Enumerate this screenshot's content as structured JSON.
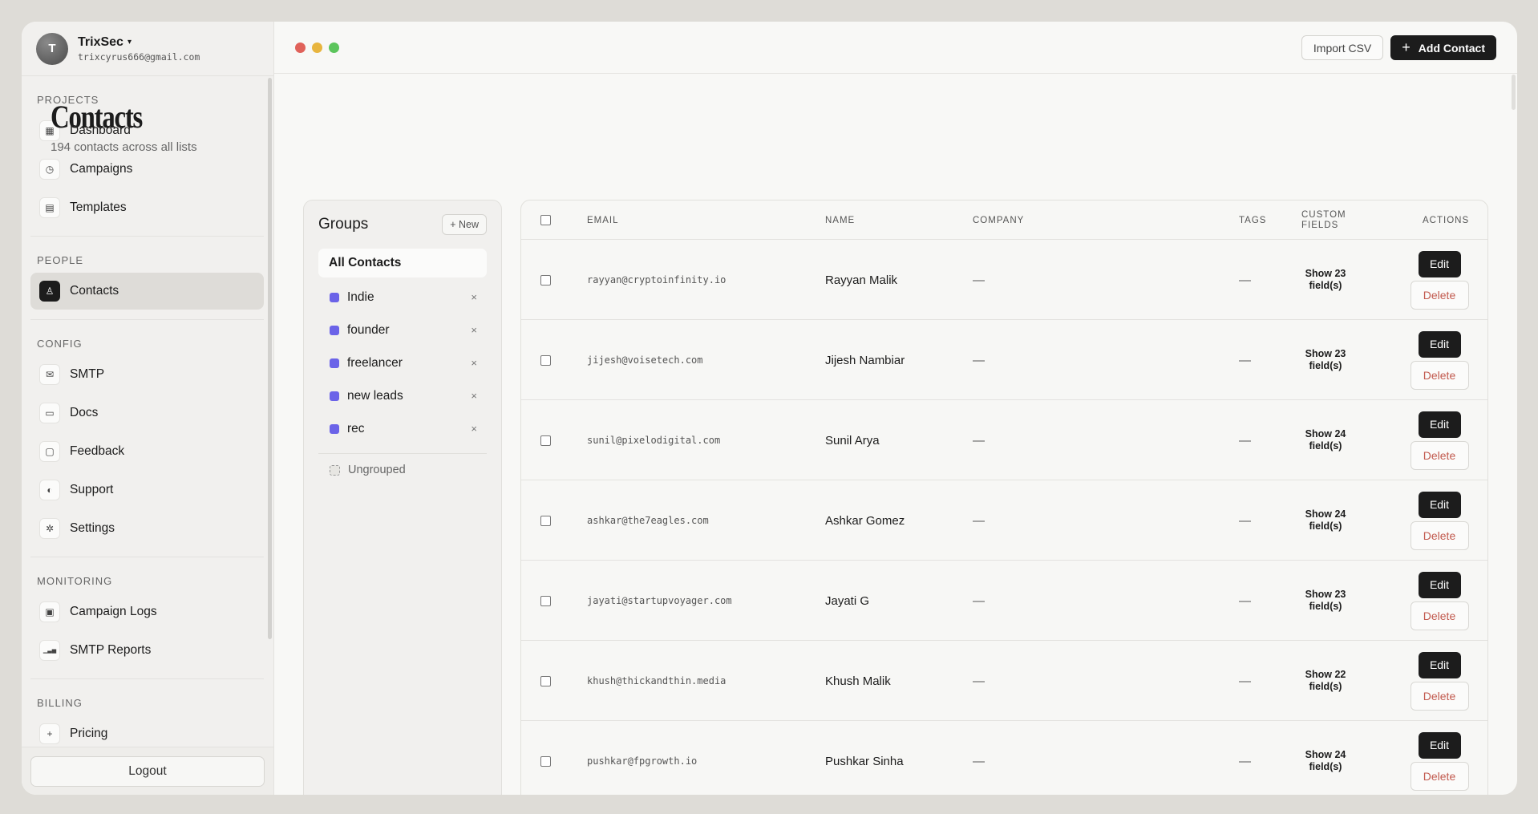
{
  "account": {
    "initial": "T",
    "name": "TrixSec",
    "caret": "▾",
    "email": "trixcyrus666@gmail.com"
  },
  "sidebar": {
    "sections": [
      {
        "title": "PROJECTS",
        "items": [
          {
            "label": "Dashboard",
            "icon": "grid-icon",
            "glyph": "▦"
          },
          {
            "label": "Campaigns",
            "icon": "clock-icon",
            "glyph": "◷"
          },
          {
            "label": "Templates",
            "icon": "document-icon",
            "glyph": "▤"
          }
        ]
      },
      {
        "title": "PEOPLE",
        "items": [
          {
            "label": "Contacts",
            "icon": "user-icon",
            "glyph": "♙",
            "active": true
          }
        ]
      },
      {
        "title": "CONFIG",
        "items": [
          {
            "label": "SMTP",
            "icon": "mail-icon",
            "glyph": "✉"
          },
          {
            "label": "Docs",
            "icon": "folder-icon",
            "glyph": "▭"
          },
          {
            "label": "Feedback",
            "icon": "chat-icon",
            "glyph": "▢"
          },
          {
            "label": "Support",
            "icon": "support-icon",
            "glyph": "◐"
          },
          {
            "label": "Settings",
            "icon": "gear-icon",
            "glyph": "✲"
          }
        ]
      },
      {
        "title": "MONITORING",
        "items": [
          {
            "label": "Campaign Logs",
            "icon": "log-icon",
            "glyph": "▣"
          },
          {
            "label": "SMTP Reports",
            "icon": "bar-chart-icon",
            "glyph": "▁▃▅"
          }
        ]
      },
      {
        "title": "BILLING",
        "items": [
          {
            "label": "Pricing",
            "icon": "plus-icon",
            "glyph": "+"
          }
        ]
      }
    ],
    "logout_label": "Logout"
  },
  "window_dots": [
    "#e0625a",
    "#e8b53e",
    "#5cc55c"
  ],
  "toolbar": {
    "import_label": "Import CSV",
    "add_label": "Add Contact",
    "add_icon": "+"
  },
  "page": {
    "title": "Contacts",
    "subtitle": "194 contacts across all lists"
  },
  "groups": {
    "title": "Groups",
    "new_label": "+ New",
    "all_label": "All Contacts",
    "items": [
      "Indie",
      "founder",
      "freelancer",
      "new leads",
      "rec"
    ],
    "remove_glyph": "×",
    "swatch_color": "#6b63e8",
    "ungrouped_label": "Ungrouped"
  },
  "table": {
    "headers": {
      "email": "EMAIL",
      "name": "NAME",
      "company": "COMPANY",
      "tags": "TAGS",
      "custom_line1": "CUSTOM",
      "custom_line2": "FIELDS",
      "actions": "ACTIONS"
    },
    "edit_label": "Edit",
    "delete_label": "Delete",
    "rows": [
      {
        "email": "rayyan@cryptoinfinity.io",
        "name": "Rayyan Malik",
        "company": "—",
        "tags": "—",
        "custom_line1": "Show 23",
        "custom_line2": "field(s)"
      },
      {
        "email": "jijesh@voisetech.com",
        "name": "Jijesh Nambiar",
        "company": "—",
        "tags": "—",
        "custom_line1": "Show 23",
        "custom_line2": "field(s)"
      },
      {
        "email": "sunil@pixelodigital.com",
        "name": "Sunil Arya",
        "company": "—",
        "tags": "—",
        "custom_line1": "Show 24",
        "custom_line2": "field(s)"
      },
      {
        "email": "ashkar@the7eagles.com",
        "name": "Ashkar Gomez",
        "company": "—",
        "tags": "—",
        "custom_line1": "Show 24",
        "custom_line2": "field(s)"
      },
      {
        "email": "jayati@startupvoyager.com",
        "name": "Jayati G",
        "company": "—",
        "tags": "—",
        "custom_line1": "Show 23",
        "custom_line2": "field(s)"
      },
      {
        "email": "khush@thickandthin.media",
        "name": "Khush Malik",
        "company": "—",
        "tags": "—",
        "custom_line1": "Show 22",
        "custom_line2": "field(s)"
      },
      {
        "email": "pushkar@fpgrowth.io",
        "name": "Pushkar Sinha",
        "company": "—",
        "tags": "—",
        "custom_line1": "Show 24",
        "custom_line2": "field(s)"
      }
    ]
  }
}
